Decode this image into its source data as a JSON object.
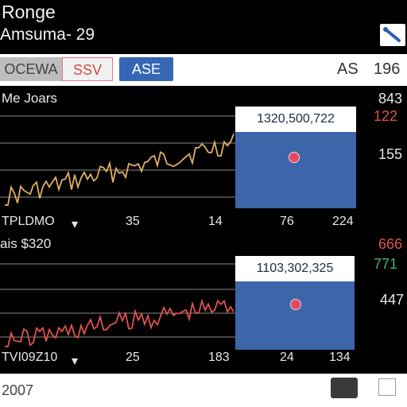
{
  "header": {
    "title": "Ronge",
    "subtitle": "Amsuma- 29"
  },
  "tabs": [
    "OCEWA",
    "SSV",
    "ASE"
  ],
  "toolbar": {
    "stat_a": "AS",
    "stat_b": "196"
  },
  "panel1": {
    "label": "Me Joars",
    "value_box": "1320,500,722",
    "axis_left": "TPLDMO",
    "axis_ticks": [
      "35",
      "14",
      "76",
      "224"
    ],
    "side_values": [
      "843",
      "122",
      "155"
    ],
    "line_color": "#e0b060"
  },
  "panel2": {
    "label": "ais $320",
    "value_box": "1103,302,325",
    "axis_left": "TVI09Z10",
    "axis_ticks": [
      "25",
      "183",
      "24",
      "134"
    ],
    "side_values": [
      "666",
      "771",
      "447"
    ],
    "line_color": "#e0524e"
  },
  "footer": {
    "text": "2007"
  },
  "colors": {
    "accent_blue": "#3567b4",
    "marker": "#e04a5c",
    "side_red": "#e05050",
    "side_green": "#3cb371"
  }
}
